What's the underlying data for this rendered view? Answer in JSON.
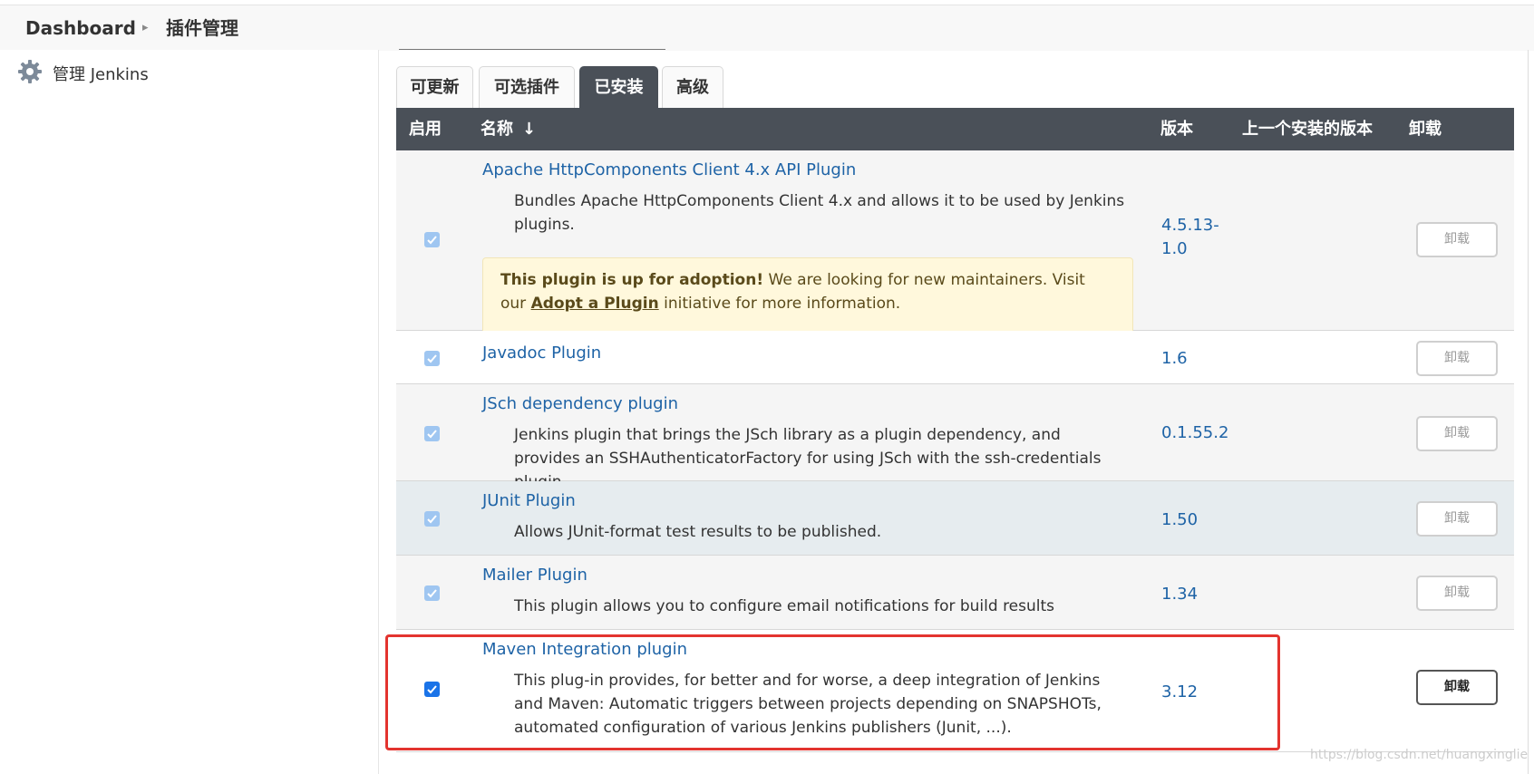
{
  "breadcrumb": {
    "home": "Dashboard",
    "current": "插件管理"
  },
  "sidebar": {
    "link_label": "管理 Jenkins",
    "icon": "gear-icon"
  },
  "tabs": [
    {
      "label": "可更新"
    },
    {
      "label": "可选插件"
    },
    {
      "label": "已安装",
      "active": true
    },
    {
      "label": "高级"
    }
  ],
  "table": {
    "headers": {
      "enabled": "启用",
      "name": "名称",
      "sort_indicator": "↓",
      "version": "版本",
      "previous_version": "上一个安装的版本",
      "uninstall": "卸载"
    },
    "rows": [
      {
        "name": "Apache HttpComponents Client 4.x API Plugin",
        "description": "Bundles Apache HttpComponents Client 4.x and allows it to be used by Jenkins plugins.",
        "adoption": {
          "strong": "This plugin is up for adoption!",
          "text_before": "We are looking for new maintainers. Visit our",
          "link": "Adopt a Plugin",
          "text_after": "initiative for more information."
        },
        "version": "4.5.13-1.0",
        "uninstall": "卸载",
        "enabled": true
      },
      {
        "name": "Javadoc Plugin",
        "description": "",
        "version": "1.6",
        "uninstall": "卸载",
        "enabled": true
      },
      {
        "name": "JSch dependency plugin",
        "description": "Jenkins plugin that brings the JSch library as a plugin dependency, and provides an SSHAuthenticatorFactory for using JSch with the ssh-credentials plugin.",
        "version": "0.1.55.2",
        "uninstall": "卸载",
        "enabled": true
      },
      {
        "name": "JUnit Plugin",
        "description": "Allows JUnit-format test results to be published.",
        "version": "1.50",
        "uninstall": "卸载",
        "enabled": true
      },
      {
        "name": "Mailer Plugin",
        "description": "This plugin allows you to configure email notifications for build results",
        "version": "1.34",
        "uninstall": "卸载",
        "enabled": true
      },
      {
        "name": "Maven Integration plugin",
        "description": "This plug-in provides, for better and for worse, a deep integration of Jenkins and Maven: Automatic triggers between projects depending on SNAPSHOTs, automated configuration of various Jenkins publishers (Junit, ...).",
        "version": "3.12",
        "uninstall": "卸载",
        "enabled": true
      }
    ]
  },
  "watermark": "https://blog.csdn.net/huangxinglie",
  "colors": {
    "header_bg": "#4a5058",
    "link": "#1e63a6",
    "adopt_bg": "#fff8dc",
    "highlight_border": "#e3342f",
    "checkbox_active": "#1a73e8"
  }
}
